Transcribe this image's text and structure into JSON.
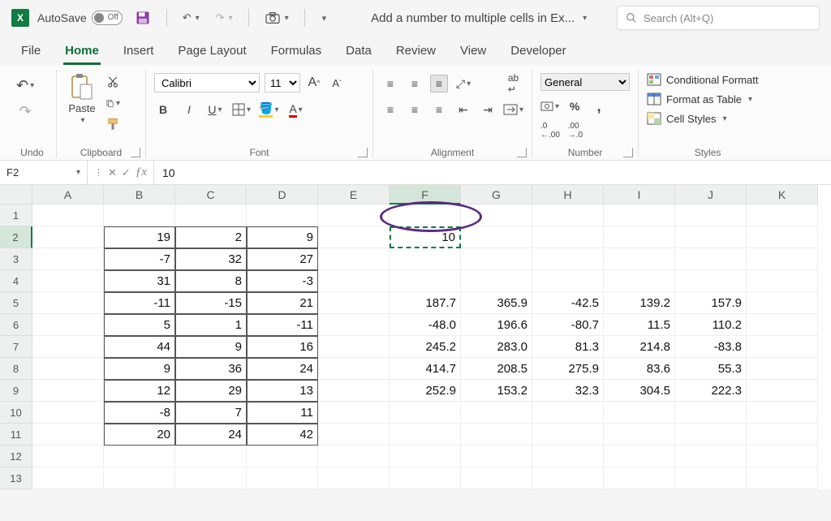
{
  "titlebar": {
    "autosave_label": "AutoSave",
    "autosave_state": "Off",
    "doc_title": "Add a number to multiple cells in Ex...",
    "search_placeholder": "Search (Alt+Q)"
  },
  "tabs": [
    "File",
    "Home",
    "Insert",
    "Page Layout",
    "Formulas",
    "Data",
    "Review",
    "View",
    "Developer"
  ],
  "active_tab": "Home",
  "ribbon": {
    "undo_label": "Undo",
    "clipboard_label": "Clipboard",
    "paste_label": "Paste",
    "font_label": "Font",
    "font_name": "Calibri",
    "font_size": "11",
    "alignment_label": "Alignment",
    "number_label": "Number",
    "number_format": "General",
    "styles_label": "Styles",
    "cond_fmt": "Conditional Formatt",
    "fmt_table": "Format as Table",
    "cell_styles": "Cell Styles"
  },
  "formula_bar": {
    "name_box": "F2",
    "formula": "10"
  },
  "grid": {
    "columns": [
      "A",
      "B",
      "C",
      "D",
      "E",
      "F",
      "G",
      "H",
      "I",
      "J",
      "K"
    ],
    "rows": 13,
    "selected_col": "F",
    "selected_row": 2,
    "bordered_range": {
      "c1": "B",
      "r1": 2,
      "c2": "D",
      "r2": 11
    },
    "cells": {
      "B2": "19",
      "C2": "2",
      "D2": "9",
      "F2": "10",
      "B3": "-7",
      "C3": "32",
      "D3": "27",
      "B4": "31",
      "C4": "8",
      "D4": "-3",
      "B5": "-11",
      "C5": "-15",
      "D5": "21",
      "F5": "187.7",
      "G5": "365.9",
      "H5": "-42.5",
      "I5": "139.2",
      "J5": "157.9",
      "B6": "5",
      "C6": "1",
      "D6": "-11",
      "F6": "-48.0",
      "G6": "196.6",
      "H6": "-80.7",
      "I6": "11.5",
      "J6": "110.2",
      "B7": "44",
      "C7": "9",
      "D7": "16",
      "F7": "245.2",
      "G7": "283.0",
      "H7": "81.3",
      "I7": "214.8",
      "J7": "-83.8",
      "B8": "9",
      "C8": "36",
      "D8": "24",
      "F8": "414.7",
      "G8": "208.5",
      "H8": "275.9",
      "I8": "83.6",
      "J8": "55.3",
      "B9": "12",
      "C9": "29",
      "D9": "13",
      "F9": "252.9",
      "G9": "153.2",
      "H9": "32.3",
      "I9": "304.5",
      "J9": "222.3",
      "B10": "-8",
      "C10": "7",
      "D10": "11",
      "B11": "20",
      "C11": "24",
      "D11": "42"
    }
  }
}
